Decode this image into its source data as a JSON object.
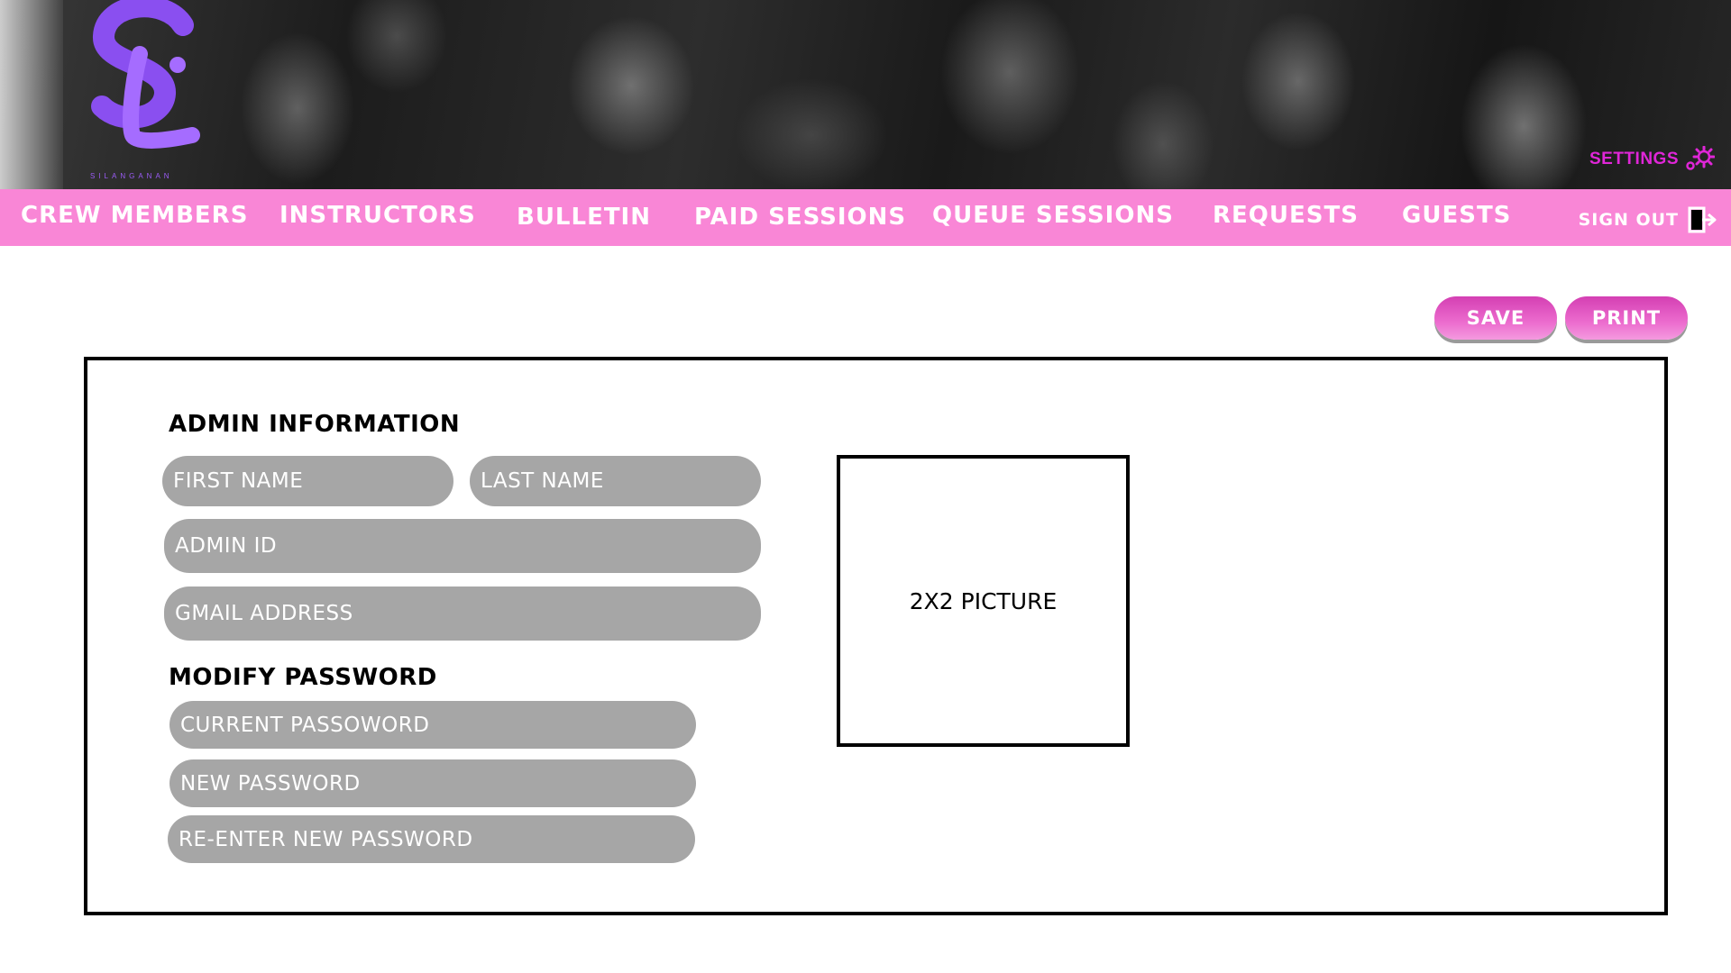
{
  "header": {
    "logo_text": "SL",
    "logo_caption": "SILANGANAN",
    "settings_label": "SETTINGS"
  },
  "nav": {
    "items": [
      {
        "label": "CREW MEMBERS"
      },
      {
        "label": "INSTRUCTORS"
      },
      {
        "label": "BULLETIN"
      },
      {
        "label": "PAID SESSIONS"
      },
      {
        "label": "QUEUE SESSIONS"
      },
      {
        "label": "REQUESTS"
      },
      {
        "label": "GUESTS"
      }
    ],
    "sign_out_label": "SIGN OUT"
  },
  "actions": {
    "save_label": "SAVE",
    "print_label": "PRINT"
  },
  "admin_info": {
    "title": "ADMIN INFORMATION",
    "first_name_placeholder": "FIRST NAME",
    "last_name_placeholder": "LAST NAME",
    "admin_id_placeholder": "ADMIN ID",
    "gmail_placeholder": "GMAIL ADDRESS"
  },
  "password": {
    "title": "MODIFY PASSWORD",
    "current_placeholder": "CURRENT PASSOWORD",
    "new_placeholder": "NEW PASSWORD",
    "reenter_placeholder": "RE-ENTER NEW PASSWORD"
  },
  "photo": {
    "label": "2X2 PICTURE"
  },
  "colors": {
    "nav_pink": "#f986d6",
    "button_pink": "#d43fb3",
    "logo_purple": "#9b5cf6",
    "settings_magenta": "#e026d8",
    "field_gray": "#a6a6a6"
  }
}
